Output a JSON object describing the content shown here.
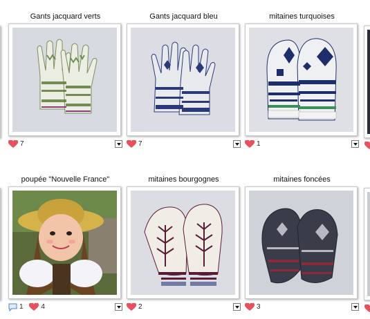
{
  "items": [
    {
      "title": "Gants jacquard verts",
      "likes": "7"
    },
    {
      "title": "Gants jacquard bleu",
      "likes": "7"
    },
    {
      "title": "mitaines turquoises",
      "likes": "1"
    },
    {
      "title": "poupée \"Nouvelle France\"",
      "comments": "1",
      "likes": "4"
    },
    {
      "title": "mitaines bourgognes",
      "likes": "2"
    },
    {
      "title": "mitaines foncées",
      "likes": "3"
    }
  ],
  "colors": {
    "heart": "#e8505b",
    "comment_bubble": "#4a86c8"
  }
}
